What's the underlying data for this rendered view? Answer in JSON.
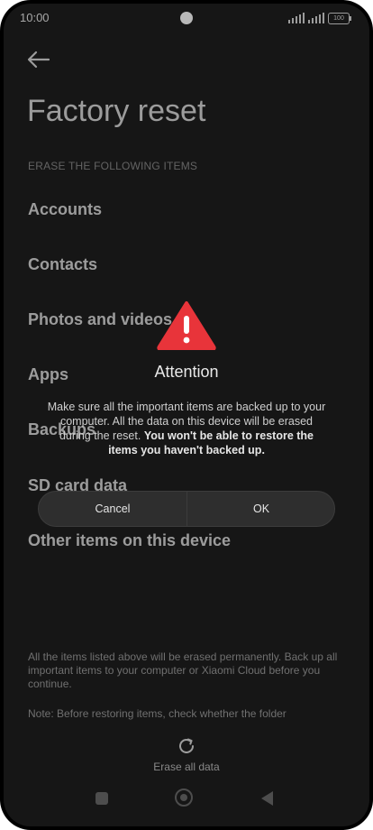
{
  "status_bar": {
    "time": "10:00",
    "battery": "100"
  },
  "page": {
    "title": "Factory reset",
    "section_label": "ERASE THE FOLLOWING ITEMS",
    "items": [
      {
        "label": "Accounts"
      },
      {
        "label": "Contacts"
      },
      {
        "label": "Photos and videos"
      },
      {
        "label": "Apps"
      },
      {
        "label": "Backups"
      },
      {
        "label": "SD card data"
      },
      {
        "label": "Other items on this device"
      }
    ],
    "footer_note_1": "All the items listed above will be erased permanently. Back up all important items to your computer or Xiaomi Cloud before you continue.",
    "footer_note_2": "Note: Before restoring items, check whether the folder",
    "erase_button_label": "Erase all data"
  },
  "dialog": {
    "title": "Attention",
    "message_plain": "Make sure all the important items are backed up to your computer. All the data on this device will be erased during the reset.",
    "message_bold": "You won't be able to restore the items you haven't backed up.",
    "cancel_label": "Cancel",
    "ok_label": "OK"
  },
  "colors": {
    "background": "#1f1f1f",
    "warning": "#e8343a",
    "text": "#d9d9d9"
  },
  "icons": [
    "back-arrow-icon",
    "warning-icon",
    "refresh-icon",
    "recents-icon",
    "home-icon",
    "back-icon"
  ]
}
